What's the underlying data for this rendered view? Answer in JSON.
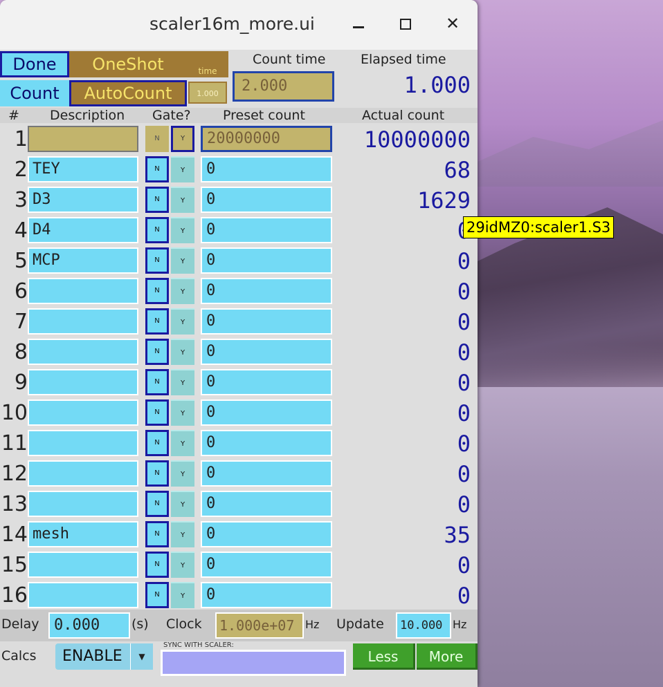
{
  "window": {
    "title": "scaler16m_more.ui"
  },
  "controls": {
    "done": "Done",
    "count": "Count",
    "oneshot": "OneShot",
    "autocount": "AutoCount",
    "time_label": "time",
    "time_value": "1.000"
  },
  "headers": {
    "count_time": "Count time",
    "elapsed_time": "Elapsed time",
    "num": "#",
    "description": "Description",
    "gate": "Gate?",
    "preset": "Preset count",
    "actual": "Actual count"
  },
  "count_time_value": "2.000",
  "elapsed_value": "1.000",
  "gate_labels": {
    "n": "N",
    "y": "Y"
  },
  "rows": [
    {
      "num": "1",
      "desc": "",
      "preset": "20000000",
      "actual": "10000000"
    },
    {
      "num": "2",
      "desc": "TEY",
      "preset": "0",
      "actual": "68"
    },
    {
      "num": "3",
      "desc": "D3",
      "preset": "0",
      "actual": "1629"
    },
    {
      "num": "4",
      "desc": "D4",
      "preset": "0",
      "actual": "0"
    },
    {
      "num": "5",
      "desc": "MCP",
      "preset": "0",
      "actual": "0"
    },
    {
      "num": "6",
      "desc": "",
      "preset": "0",
      "actual": "0"
    },
    {
      "num": "7",
      "desc": "",
      "preset": "0",
      "actual": "0"
    },
    {
      "num": "8",
      "desc": "",
      "preset": "0",
      "actual": "0"
    },
    {
      "num": "9",
      "desc": "",
      "preset": "0",
      "actual": "0"
    },
    {
      "num": "10",
      "desc": "",
      "preset": "0",
      "actual": "0"
    },
    {
      "num": "11",
      "desc": "",
      "preset": "0",
      "actual": "0"
    },
    {
      "num": "12",
      "desc": "",
      "preset": "0",
      "actual": "0"
    },
    {
      "num": "13",
      "desc": "",
      "preset": "0",
      "actual": "0"
    },
    {
      "num": "14",
      "desc": "mesh",
      "preset": "0",
      "actual": "35"
    },
    {
      "num": "15",
      "desc": "",
      "preset": "0",
      "actual": "0"
    },
    {
      "num": "16",
      "desc": "",
      "preset": "0",
      "actual": "0"
    }
  ],
  "tooltip": "29idMZ0:scaler1.S3",
  "bottom": {
    "delay_label": "Delay",
    "delay_value": "0.000",
    "delay_unit": "(s)",
    "clock_label": "Clock",
    "clock_value": "1.000e+07",
    "clock_unit": "Hz",
    "update_label": "Update",
    "update_value": "10.000",
    "update_unit": "Hz",
    "calcs_label": "Calcs",
    "calcs_value": "ENABLE",
    "sync_label": "SYNC WITH SCALER:",
    "less": "Less",
    "more": "More"
  }
}
